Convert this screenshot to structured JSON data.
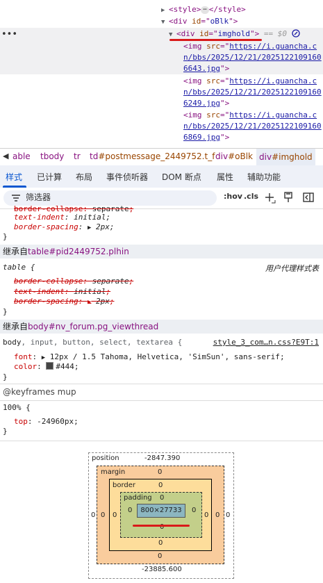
{
  "dom": {
    "lines": [
      {
        "open": "<style>",
        "close": "</style>"
      },
      {
        "text": "<div id=\"oBlk\">",
        "tag": "div",
        "attr": "id",
        "value": "oBlk"
      },
      {
        "tag": "div",
        "attr": "id",
        "value": "imghold",
        "suffix": "== $0"
      },
      {
        "tag": "img",
        "attr": "src",
        "url_lines": [
          "https://i.guancha.c",
          "n/bbs/2025/12/21/2025122109160",
          "6643.jpg"
        ]
      },
      {
        "tag": "img",
        "attr": "src",
        "url_lines": [
          "https://i.guancha.c",
          "n/bbs/2025/12/21/2025122109160",
          "6249.jpg"
        ]
      },
      {
        "tag": "img",
        "attr": "src",
        "url_lines": [
          "https://i.guancha.c",
          "n/bbs/2025/12/21/2025122109160",
          "6869.jpg"
        ]
      }
    ],
    "dots": "•••"
  },
  "breadcrumb": {
    "items": [
      "able",
      "tbody",
      "tr",
      "td#postmessage_2449752.t_f",
      "div#oBlk",
      "div#imghold"
    ],
    "td_tag": "td",
    "td_id": "#postmessage_2449752.t_f",
    "div1_tag": "div",
    "div1_id": "#oBlk",
    "div2_tag": "div",
    "div2_id": "#imghold"
  },
  "tabs": [
    "样式",
    "已计算",
    "布局",
    "事件侦听器",
    "DOM 断点",
    "属性",
    "辅助功能"
  ],
  "filter": {
    "placeholder": "筛选器",
    "hov": ":hov",
    "cls": ".cls"
  },
  "styles": {
    "top_rule": {
      "lines": [
        {
          "prop": "border-collapse",
          "value": "separate",
          "struck": true
        },
        {
          "prop": "text-indent",
          "value": "initial"
        },
        {
          "prop": "border-spacing",
          "value": "2px"
        }
      ],
      "close": "}"
    },
    "inherit1": {
      "label": "继承自",
      "tag": "table",
      "selector": "#pid2449752.plhin"
    },
    "ua_rule": {
      "selector": "table {",
      "source": "用户代理样式表",
      "lines": [
        {
          "prop": "border-collapse",
          "value": "separate"
        },
        {
          "prop": "text-indent",
          "value": "initial"
        },
        {
          "prop": "border-spacing",
          "value": "2px"
        }
      ],
      "close": "}"
    },
    "inherit2": {
      "label": "继承自",
      "tag": "body",
      "selector": "#nv_forum.pg_viewthread"
    },
    "body_rule": {
      "selector_main": "body",
      "selector_rest": ", input, button, select, textarea {",
      "source": "style_3_com…n.css?E9T:1",
      "lines": [
        {
          "prop": "font",
          "value": "12px / 1.5 Tahoma, Helvetica, 'SimSun', sans-serif"
        },
        {
          "prop": "color",
          "value": "#444"
        }
      ],
      "close": "}"
    },
    "keyframes": {
      "header": "@keyframes mup",
      "selector": "100% {",
      "lines": [
        {
          "prop": "top",
          "value": "-24960px"
        }
      ],
      "close": "}"
    }
  },
  "box_model": {
    "position_label": "position",
    "position_top": "-2847.390",
    "position_bottom": "-23885.600",
    "position_left": "0",
    "position_right": "0",
    "margin_label": "margin",
    "margin_top": "0",
    "margin_bottom": "0",
    "margin_left": "0",
    "margin_right": "0",
    "border_label": "border",
    "border_top": "0",
    "border_bottom": "0",
    "border_left": "0",
    "border_right": "0",
    "padding_label": "padding",
    "padding_top": "0",
    "padding_bottom": "0",
    "padding_left": "0",
    "padding_right": "0",
    "content": "800×27733"
  },
  "colors": {
    "accent": "#0b57d0",
    "annotation_red": "#d91a1a"
  }
}
